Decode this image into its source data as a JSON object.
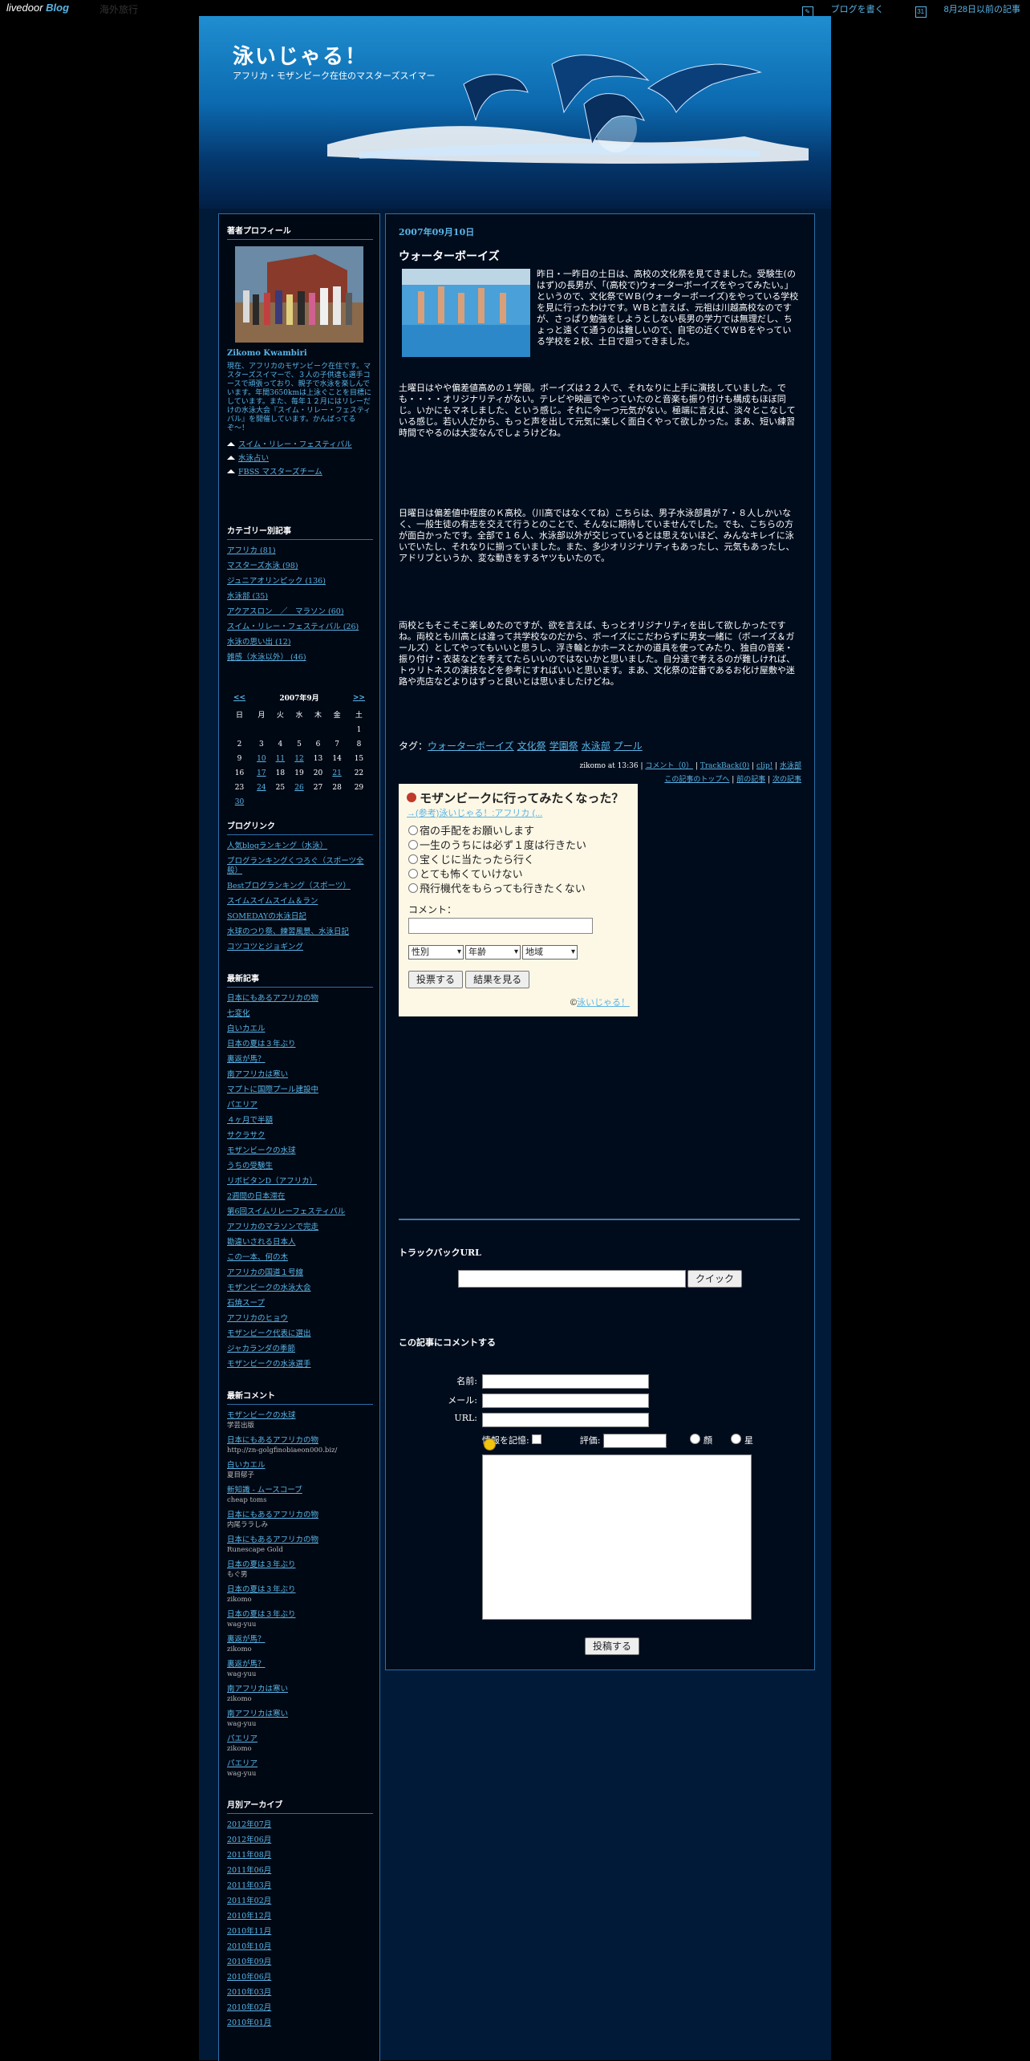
{
  "topbar": {
    "logo": "livedoor",
    "logo_suffix": "Blog",
    "blog_name": "海外旅行",
    "write_link": "ブログを書く",
    "date_link": "8月28日以前の記事"
  },
  "header": {
    "title": "泳いじゃる！",
    "subtitle": "アフリカ・モザンビーク在住のマスターズスイマー"
  },
  "sidebar": {
    "profile": {
      "heading": "著者プロフィール",
      "name": "Zikomo Kwambiri",
      "text": "現在、アフリカのモザンビーク在住です。マスターズスイマーで、３人の子供達も選手コースで頑張っており、親子で水泳を楽しんでいます。年間3650kmは上泳ぐことを目標にしています。また、毎年１２月にはリレーだけの水泳大会『スイム・リレー・フェスティバル』を開催しています。かんばってるぞ〜！",
      "links": [
        "スイム・リレー・フェスティバル",
        "水泳占い",
        "FBSS マスターズチーム"
      ]
    },
    "categories": {
      "heading": "カテゴリー別記事",
      "items": [
        "アフリカ (81)",
        "マスターズ水泳 (98)",
        "ジュニアオリンピック (136)",
        "水泳部 (35)",
        "アクアスロン　／　マラソン (60)",
        "スイム・リレー・フェスティバル (26)",
        "水泳の思い出 (12)",
        "雑感（水泳以外） (46)"
      ]
    },
    "calendar": {
      "prev": "<<",
      "title": "2007年9月",
      "next": ">>",
      "weekdays": [
        "日",
        "月",
        "火",
        "水",
        "木",
        "金",
        "土"
      ],
      "weeks": [
        [
          "",
          "",
          "",
          "",
          "",
          "",
          "1"
        ],
        [
          "2",
          "3",
          "4",
          "5",
          "6",
          "7",
          "8"
        ],
        [
          "9",
          "10",
          "11",
          "12",
          "13",
          "14",
          "15"
        ],
        [
          "16",
          "17",
          "18",
          "19",
          "20",
          "21",
          "22"
        ],
        [
          "23",
          "24",
          "25",
          "26",
          "27",
          "28",
          "29"
        ],
        [
          "30",
          "",
          "",
          "",
          "",
          "",
          ""
        ]
      ]
    },
    "blogroll": {
      "heading": "ブログリンク",
      "items": [
        "人気blogランキング（水泳）",
        "ブログランキングくつろぐ（スポーツ全般）",
        "Bestブログランキング（スポーツ）",
        "スイムスイムスイム＆ラン",
        "SOMEDAYの水泳日記",
        "水球のつり祭、練習風景、水泳日記",
        "コツコツとジョギング"
      ]
    },
    "recent": {
      "heading": "最新記事",
      "items": [
        "日本にもあるアフリカの物",
        "七変化",
        "白いカエル",
        "日本の夏は３年ぶり",
        "裏返が馬？",
        "南アフリカは寒い",
        "マプトに国際プール建設中",
        "パエリア",
        "４ヶ月で半額",
        "サクラサク",
        "モザンビークの水球",
        "うちの受験生",
        "リボビタンD（アフリカ）",
        "2週間の日本滞在",
        "第6回スイムリレーフェスティバル",
        "アフリカのマラソンで完走",
        "勘違いされる日本人",
        "この一本、何の木",
        "アフリカの国道１号線",
        "モザンビークの水泳大会",
        "石焼スープ",
        "アフリカのヒョウ",
        "モザンビーク代表に選出",
        "ジャカランダの季節",
        "モザンビークの水泳選手"
      ]
    },
    "comments": {
      "heading": "最新コメント",
      "items": [
        {
          "title": "モザンビークの水球",
          "by": "学芸出版"
        },
        {
          "title": "日本にもあるアフリカの物",
          "by": "http://zn-golgfinobiaeon000.biz/"
        },
        {
          "title": "白いカエル",
          "by": "夏目郁子"
        },
        {
          "title": "新知識 - ムースコーブ",
          "by": "cheap toms"
        },
        {
          "title": "日本にもあるアフリカの物",
          "by": "内尾ララしみ"
        },
        {
          "title": "日本にもあるアフリカの物",
          "by": "Runescape Gold"
        },
        {
          "title": "日本の夏は３年ぶり",
          "by": "もぐ男"
        },
        {
          "title": "日本の夏は３年ぶり",
          "by": "zikomo"
        },
        {
          "title": "日本の夏は３年ぶり",
          "by": "wag-yuu"
        },
        {
          "title": "裏返が馬？",
          "by": "zikomo"
        },
        {
          "title": "裏返が馬？",
          "by": "wag-yuu"
        },
        {
          "title": "南アフリカは寒い",
          "by": "zikomo"
        },
        {
          "title": "南アフリカは寒い",
          "by": "wag-yuu"
        },
        {
          "title": "パエリア",
          "by": "zikomo"
        },
        {
          "title": "パエリア",
          "by": "wag-yuu"
        }
      ]
    },
    "archive": {
      "heading": "月別アーカイブ",
      "items": [
        "2012年07月",
        "2012年06月",
        "2011年08月",
        "2011年06月",
        "2011年03月",
        "2011年02月",
        "2010年12月",
        "2010年11月",
        "2010年10月",
        "2010年09月",
        "2010年06月",
        "2010年03月",
        "2010年02月",
        "2010年01月"
      ]
    }
  },
  "entry": {
    "date": "2007年09月10日",
    "title": "ウォーターボーイズ",
    "para1": "昨日・一昨日の土日は、高校の文化祭を見てきました。受験生(のはず)の長男が、「(高校で)ウォーターボーイズをやってみたい。」というので、文化祭でＷＢ(ウォーターボーイズ)をやっている学校を見に行ったわけです。ＷＢと言えば、元祖は川越高校なのですが、さっぱり勉強をしようとしない長男の学力では無理だし、ちょっと遠くて通うのは難しいので、自宅の近くでＷＢをやっている学校を２校、土日で廻ってきました。",
    "para2": "土曜日はやや偏差値高めの１学園。ボーイズは２２人で、それなりに上手に演技していました。でも・・・・オリジナリティがない。テレビや映画でやっていたのと音楽も振り付けも構成もほぼ同じ。いかにもマネしました、という感じ。それに今一つ元気がない。極端に言えば、淡々とこなしている感じ。若い人だから、もっと声を出して元気に楽しく面白くやって欲しかった。まあ、短い練習時間でやるのは大変なんでしょうけどね。",
    "para3": "日曜日は偏差値中程度のＫ高校。（川高ではなくてね）こちらは、男子水泳部員が７・８人しかいなく、一般生徒の有志を交えて行うとのことで、そんなに期待していませんでした。でも、こちらの方が面白かったです。全部で１６人、水泳部以外が交じっているとは思えないほど、みんなキレイに泳いでいたし、それなりに揃っていました。また、多少オリジナリティもあったし、元気もあったし、アドリブというか、変な動きをするヤツもいたので。",
    "para4": "両校ともそこそこ楽しめたのですが、欲を言えば、もっとオリジナリティを出して欲しかったですね。両校とも川高とは違って共学校なのだから、ボーイズにこだわらずに男女一緒に（ボーイズ＆ガールズ）としてやってもいいと思うし、浮き輪とかホースとかの道具を使ってみたり、独自の音楽・振り付け・衣装などを考えてたらいいのではないかと思いました。自分達で考えるのが難しければ、トゥリトネスの演技などを参考にすればいいと思います。まあ、文化祭の定番であるお化け屋敷や迷路や売店などよりはずっと良いとは思いましたけどね。",
    "tags_label": "タグ：",
    "tags": [
      "ウォーターボーイズ",
      "文化祭",
      "学園祭",
      "水泳部",
      "プール"
    ],
    "meta_author": "zikomo at 13:36",
    "meta_links": [
      "コメント（0）",
      "TrackBack(0)",
      "clip!",
      "水泳部"
    ],
    "nav_links": [
      "この記事のトップへ",
      "前の記事",
      "次の記事"
    ]
  },
  "poll": {
    "question": "モザンビークに行ってみたくなった？",
    "ref": "→(参考)泳いじゃる！:アフリカ (...",
    "options": [
      "宿の手配をお願いします",
      "一生のうちには必ず１度は行きたい",
      "宝くじに当たったら行く",
      "とても怖くていけない",
      "飛行機代をもらっても行きたくない"
    ],
    "comment_label": "コメント：",
    "selects": [
      "性別",
      "年齢",
      "地域"
    ],
    "vote_button": "投票する",
    "result_button": "結果を見る",
    "credit_prefix": "©",
    "credit_link": "泳いじゃる！"
  },
  "trackback": {
    "heading": "トラックバックURL",
    "button": "クイック"
  },
  "comment_form": {
    "heading": "この記事にコメントする",
    "name_label": "名前:",
    "mail_label": "メール:",
    "url_label": "URL:",
    "remember_label": "情報を記憶:",
    "rating_label": "評価:",
    "rating_value": "--",
    "face_label": "顔",
    "star_label": "星",
    "submit": "投稿する"
  }
}
